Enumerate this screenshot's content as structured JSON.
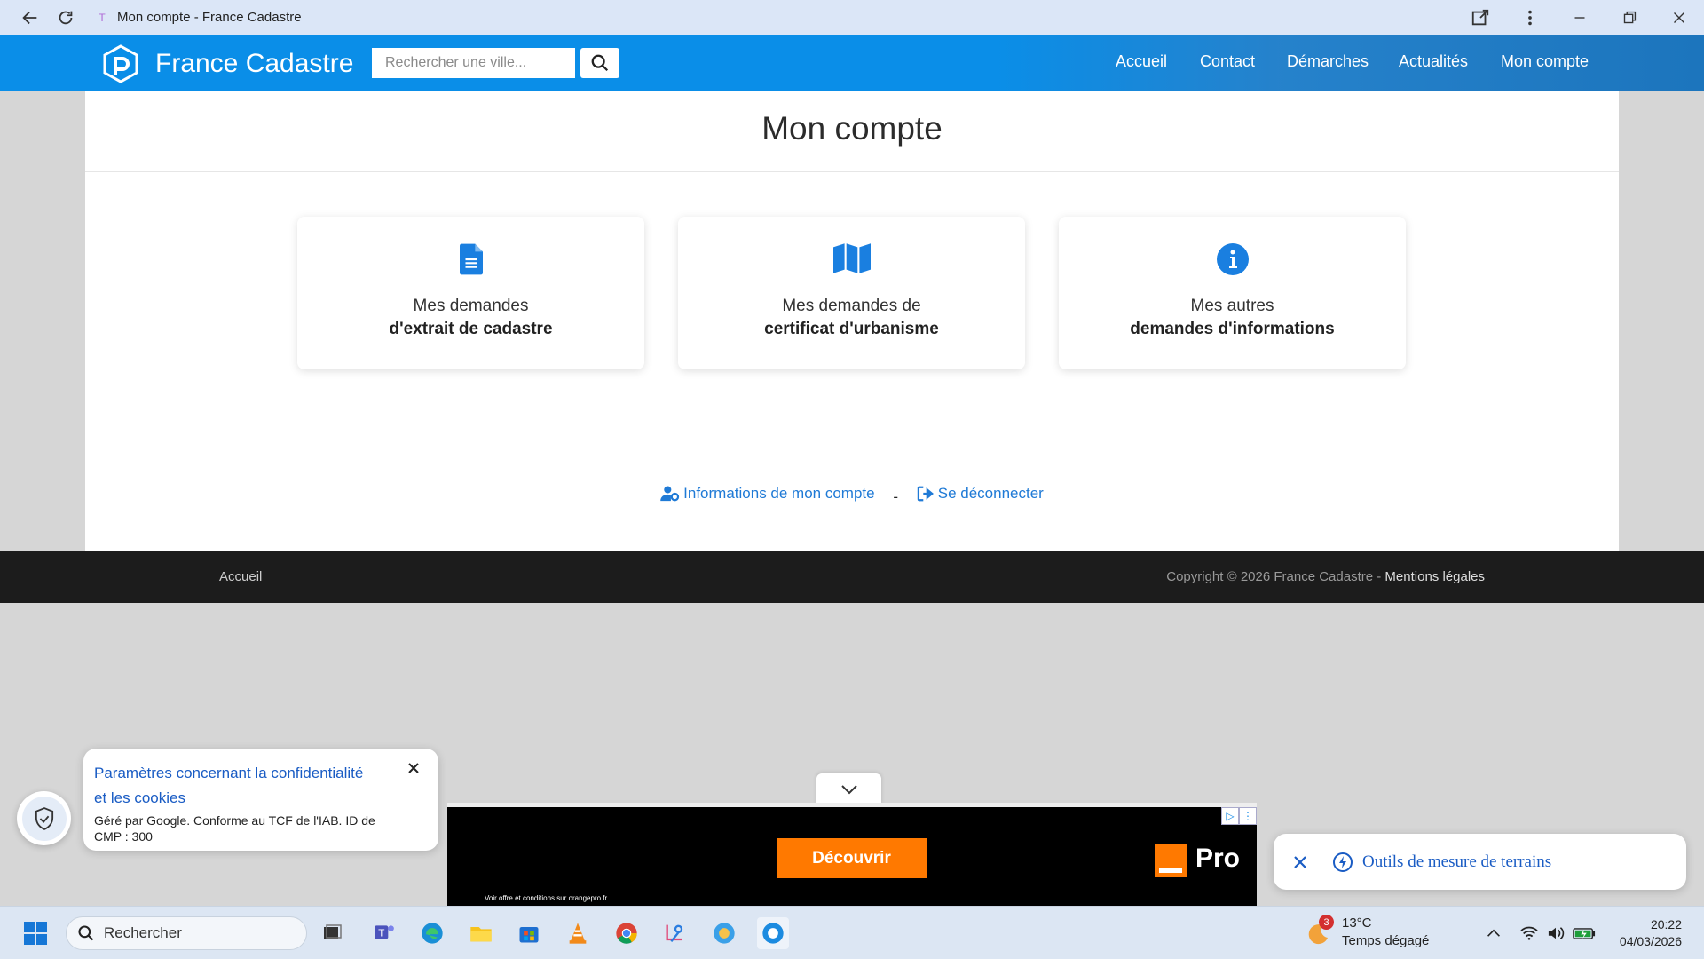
{
  "browser": {
    "tab_title": "Mon compte - France Cadastre",
    "favicon": "T"
  },
  "header": {
    "brand": "France Cadastre",
    "search_placeholder": "Rechercher une ville...",
    "nav": [
      "Accueil",
      "Contact",
      "Démarches",
      "Actualités",
      "Mon compte"
    ],
    "color": "#0a8ee8"
  },
  "main": {
    "title": "Mon compte",
    "cards": [
      {
        "icon": "document-icon",
        "line1": "Mes demandes",
        "line2": "d'extrait de cadastre"
      },
      {
        "icon": "map-icon",
        "line1": "Mes demandes de",
        "line2": "certificat d'urbanisme"
      },
      {
        "icon": "info-icon",
        "line1": "Mes autres",
        "line2": "demandes d'informations"
      }
    ],
    "account_link": "Informations de mon compte",
    "separator": "-",
    "logout_link": "Se déconnecter"
  },
  "footer": {
    "home": "Accueil",
    "copyright": "Copyright © 2026 France Cadastre - ",
    "legal": "Mentions légales"
  },
  "cookie": {
    "title": "Paramètres concernant la confidentialité et les cookies",
    "text": "Géré par Google. Conforme au TCF de l'IAB. ID de CMP : 300"
  },
  "ad": {
    "cta": "Découvrir",
    "brand": "Pro",
    "small": "Voir offre et conditions sur orangepro.fr"
  },
  "tool_banner": {
    "label": "Outils de mesure de terrains"
  },
  "taskbar": {
    "search": "Rechercher",
    "weather_badge": "3",
    "temperature": "13°C",
    "weather_desc": "Temps dégagé",
    "time": "20:22",
    "date": "04/03/2026"
  }
}
